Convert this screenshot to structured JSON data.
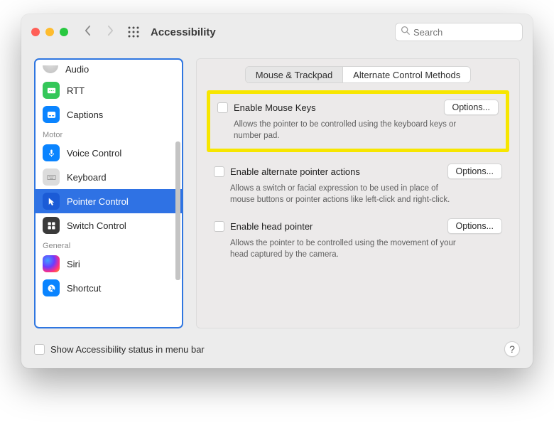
{
  "titlebar": {
    "title": "Accessibility",
    "search_placeholder": "Search"
  },
  "sidebar": {
    "items": [
      {
        "label": "Audio"
      },
      {
        "label": "RTT"
      },
      {
        "label": "Captions"
      }
    ],
    "group_motor": "Motor",
    "motor": [
      {
        "label": "Voice Control"
      },
      {
        "label": "Keyboard"
      },
      {
        "label": "Pointer Control"
      },
      {
        "label": "Switch Control"
      }
    ],
    "group_general": "General",
    "general": [
      {
        "label": "Siri"
      },
      {
        "label": "Shortcut"
      }
    ]
  },
  "tabs": {
    "mouse_trackpad": "Mouse & Trackpad",
    "alt_methods": "Alternate Control Methods"
  },
  "mouse_keys": {
    "label": "Enable Mouse Keys",
    "options_btn": "Options...",
    "desc": "Allows the pointer to be controlled using the keyboard keys or number pad."
  },
  "alt_pointer": {
    "label": "Enable alternate pointer actions",
    "options_btn": "Options...",
    "desc": "Allows a switch or facial expression to be used in place of mouse buttons or pointer actions like left-click and right-click."
  },
  "head_pointer": {
    "label": "Enable head pointer",
    "options_btn": "Options...",
    "desc": "Allows the pointer to be controlled using the movement of your head captured by the camera."
  },
  "bottom": {
    "show_status": "Show Accessibility status in menu bar",
    "help": "?"
  }
}
